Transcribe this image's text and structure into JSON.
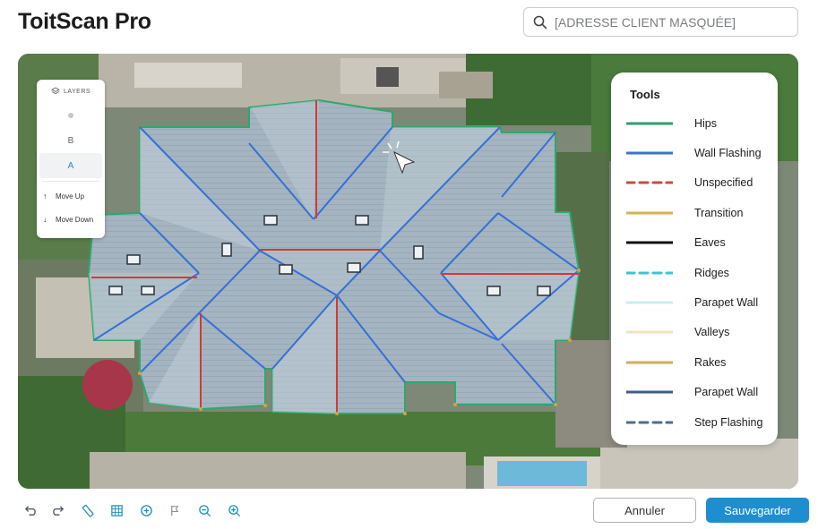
{
  "app": {
    "title": "ToitScan Pro"
  },
  "search": {
    "placeholder": "[ADRESSE CLIENT MASQUÉE]",
    "icon": "search-icon"
  },
  "layers_panel": {
    "header": "LAYERS",
    "items": [
      {
        "label": "",
        "kind": "dot"
      },
      {
        "label": "B"
      },
      {
        "label": "A",
        "active": true
      }
    ],
    "actions": [
      {
        "label": "Move Up",
        "icon": "arrow-up-icon"
      },
      {
        "label": "Move Down",
        "icon": "arrow-down-icon"
      }
    ]
  },
  "tools_panel": {
    "title": "Tools",
    "items": [
      {
        "label": "Hips",
        "color": "#2e9e6e",
        "style": "solid"
      },
      {
        "label": "Wall Flashing",
        "color": "#3b74c4",
        "style": "solid"
      },
      {
        "label": "Unspecified",
        "color": "#c0503c",
        "style": "dashed"
      },
      {
        "label": "Transition",
        "color": "#d9b24c",
        "style": "solid"
      },
      {
        "label": "Eaves",
        "color": "#111111",
        "style": "solid"
      },
      {
        "label": "Ridges",
        "color": "#3cc4cf",
        "style": "dashed"
      },
      {
        "label": "Parapet Wall",
        "color": "#c7eef2",
        "style": "solid"
      },
      {
        "label": "Valleys",
        "color": "#f3e2c0",
        "style": "solid"
      },
      {
        "label": "Rakes",
        "color": "#d3ab5a",
        "style": "solid"
      },
      {
        "label": "Parapet Wall",
        "color": "#3d5e8c",
        "style": "solid"
      },
      {
        "label": "Step Flashing",
        "color": "#4a6f8a",
        "style": "dashed"
      }
    ]
  },
  "toolbar": {
    "tools": [
      "undo-icon",
      "redo-icon",
      "measure-icon",
      "grid-icon",
      "add-point-icon",
      "flag-icon",
      "zoom-out-icon",
      "zoom-in-icon"
    ]
  },
  "actions": {
    "cancel": "Annuler",
    "save": "Sauvegarder"
  },
  "colors": {
    "accent": "#1e8ed1",
    "hip_line": "#2ea86a",
    "wall_flashing": "#3670d6",
    "unspecified": "#d03a36"
  }
}
